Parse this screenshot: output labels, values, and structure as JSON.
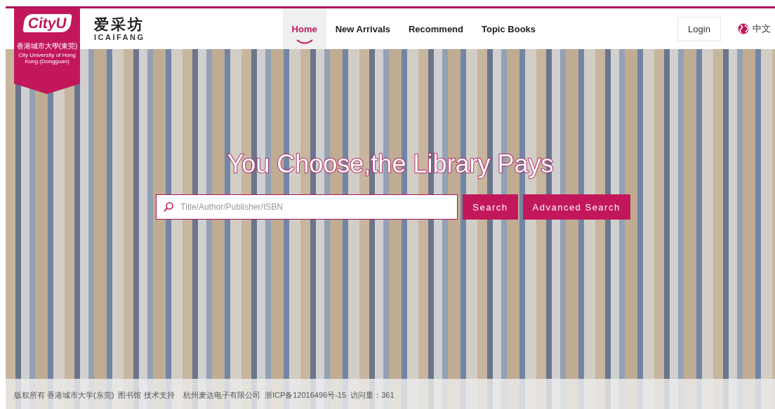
{
  "logo": {
    "brand": "CityU",
    "name_zh": "香港城市大學(東莞)",
    "name_en": "City University of Hong Kong (Dongguan)"
  },
  "site": {
    "name_zh": "爱采坊",
    "name_en": "ICAIFANG"
  },
  "nav": [
    {
      "label": "Home",
      "selected": true
    },
    {
      "label": "New Arrivals",
      "selected": false
    },
    {
      "label": "Recommend",
      "selected": false
    },
    {
      "label": "Topic Books",
      "selected": false
    }
  ],
  "login": "Login",
  "language": "中文",
  "hero": {
    "headline": "You Choose,the Library Pays",
    "search": {
      "placeholder": "Title/Author/Publisher/ISBN"
    },
    "buttons": [
      "Search",
      "Advanced Search"
    ]
  },
  "footer": "版权所有 香港城市大学(东莞)  图书馆 技术支持    杭州麦达电子有限公司  浙ICP备12016496号-15  访问量：361"
}
